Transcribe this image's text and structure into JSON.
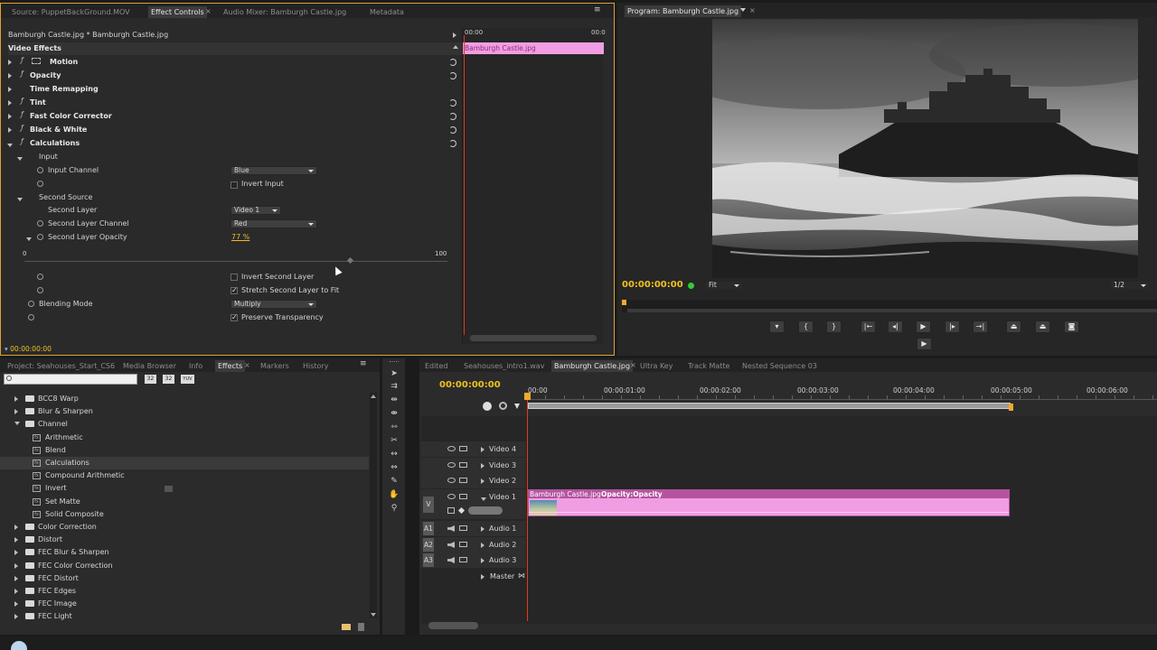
{
  "effect_controls": {
    "tabs": [
      "Source: PuppetBackGround.MOV",
      "Effect Controls",
      "Audio Mixer: Bamburgh Castle.jpg",
      "Metadata"
    ],
    "clip_title": "Bamburgh Castle.jpg * Bamburgh Castle.jpg",
    "timeline_time": "00:00",
    "timeline_end": "00:0",
    "clip_bar_label": "Bamburgh Castle.jpg",
    "section_header": "Video Effects",
    "effects": [
      "Motion",
      "Opacity",
      "Time Remapping",
      "Tint",
      "Fast Color Corrector",
      "Black & White",
      "Calculations"
    ],
    "calc": {
      "input_group": "Input",
      "input_channel_label": "Input Channel",
      "input_channel_value": "Blue",
      "invert_input": "Invert Input",
      "second_source_group": "Second Source",
      "second_layer_label": "Second Layer",
      "second_layer_value": "Video 1",
      "second_channel_label": "Second Layer Channel",
      "second_channel_value": "Red",
      "opacity_label": "Second Layer Opacity",
      "opacity_value": "77 %",
      "opacity_fraction": 0.77,
      "slider_min": "0",
      "slider_max": "100",
      "invert_second": "Invert Second Layer",
      "stretch_second": "Stretch Second Layer to Fit",
      "blending_mode_label": "Blending Mode",
      "blending_mode_value": "Multiply",
      "preserve_transparency": "Preserve Transparency"
    },
    "footer_time": "00:00:00:00"
  },
  "program": {
    "tab": "Program: Bamburgh Castle.jpg",
    "timecode": "00:00:00:00",
    "fit": "Fit",
    "resolution": "1/2"
  },
  "effects_panel": {
    "tabs": [
      "Project: Seahouses_Start_CS6",
      "Media Browser",
      "Info",
      "Effects",
      "Markers",
      "History"
    ],
    "search_placeholder": "",
    "badges": [
      "32",
      "32",
      "YUV"
    ],
    "items": [
      {
        "label": "BCC8 Warp",
        "type": "folder",
        "level": 1
      },
      {
        "label": "Blur & Sharpen",
        "type": "folder",
        "level": 1
      },
      {
        "label": "Channel",
        "type": "folder-open",
        "level": 1
      },
      {
        "label": "Arithmetic",
        "type": "effect",
        "level": 2
      },
      {
        "label": "Blend",
        "type": "effect",
        "level": 2
      },
      {
        "label": "Calculations",
        "type": "effect",
        "level": 2
      },
      {
        "label": "Compound Arithmetic",
        "type": "effect",
        "level": 2
      },
      {
        "label": "Invert",
        "type": "effect",
        "level": 2
      },
      {
        "label": "Set Matte",
        "type": "effect",
        "level": 2
      },
      {
        "label": "Solid Composite",
        "type": "effect",
        "level": 2
      },
      {
        "label": "Color Correction",
        "type": "folder",
        "level": 1
      },
      {
        "label": "Distort",
        "type": "folder",
        "level": 1
      },
      {
        "label": "FEC Blur & Sharpen",
        "type": "folder",
        "level": 1
      },
      {
        "label": "FEC Color Correction",
        "type": "folder",
        "level": 1
      },
      {
        "label": "FEC Distort",
        "type": "folder",
        "level": 1
      },
      {
        "label": "FEC Edges",
        "type": "folder",
        "level": 1
      },
      {
        "label": "FEC Image",
        "type": "folder",
        "level": 1
      },
      {
        "label": "FEC Light",
        "type": "folder",
        "level": 1
      }
    ]
  },
  "timeline": {
    "tabs": [
      "Edited",
      "Seahouses_intro1.wav",
      "Bamburgh Castle.jpg",
      "Ultra Key",
      "Track Matte",
      "Nested Sequence 03"
    ],
    "timecode": "00:00:00:00",
    "ruler": [
      "00:00",
      "00:00:01:00",
      "00:00:02:00",
      "00:00:03:00",
      "00:00:04:00",
      "00:00:05:00",
      "00:00:06:00"
    ],
    "video_tracks": [
      "Video 4",
      "Video 3",
      "Video 2",
      "Video 1"
    ],
    "audio_tracks": [
      {
        "id": "A1",
        "name": "Audio 1"
      },
      {
        "id": "A2",
        "name": "Audio 2"
      },
      {
        "id": "A3",
        "name": "Audio 3"
      }
    ],
    "master": "Master",
    "v_label": "V",
    "clip_name": "Bamburgh Castle.jpg",
    "clip_fx": "Opacity:Opacity"
  },
  "colors": {
    "accent_orange": "#f0a830",
    "clip_pink": "#f19de3",
    "clip_purple": "#b454a0",
    "timecode_yellow": "#f0c020",
    "playhead_red": "#e03a1a"
  }
}
